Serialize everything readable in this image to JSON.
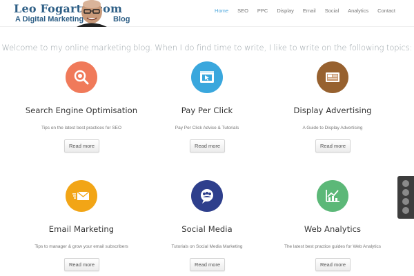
{
  "logo": {
    "name": "Leo Fogarty .com",
    "tagline": "A Digital Marketing",
    "tagline_end": "Blog"
  },
  "nav": {
    "items": [
      {
        "label": "Home",
        "active": true
      },
      {
        "label": "SEO",
        "active": false
      },
      {
        "label": "PPC",
        "active": false
      },
      {
        "label": "Display",
        "active": false
      },
      {
        "label": "Email",
        "active": false
      },
      {
        "label": "Social",
        "active": false
      },
      {
        "label": "Analytics",
        "active": false
      },
      {
        "label": "Contact",
        "active": false
      }
    ]
  },
  "intro": "Welcome to my online marketing blog. When I do find time to write, I like to write on the following topics:",
  "features": [
    {
      "title": "Search Engine Optimisation",
      "desc": "Tips on the latest best practices for SEO",
      "button": "Read more",
      "icon": "search-icon",
      "color": "#f07a5a"
    },
    {
      "title": "Pay Per Click",
      "desc": "Pay Per Click Advice & Tutorials",
      "button": "Read more",
      "icon": "browser-click-icon",
      "color": "#3aa7dd"
    },
    {
      "title": "Display Advertising",
      "desc": "A Guide to Display Advertising",
      "button": "Read more",
      "icon": "ad-display-icon",
      "color": "#97612f"
    },
    {
      "title": "Email Marketing",
      "desc": "Tips to manager & grow your email subscribers",
      "button": "Read more",
      "icon": "envelope-icon",
      "color": "#f2a516"
    },
    {
      "title": "Social Media",
      "desc": "Tutorials on Social Media Marketing",
      "button": "Read more",
      "icon": "social-chat-icon",
      "color": "#2e3f8c"
    },
    {
      "title": "Web Analytics",
      "desc": "The latest best practice guides for Web Analytics",
      "button": "Read more",
      "icon": "analytics-chart-icon",
      "color": "#5cb878"
    }
  ],
  "social": {
    "items": [
      {
        "icon": "facebook-icon",
        "glyph": "f"
      },
      {
        "icon": "twitter-icon",
        "glyph": "t"
      },
      {
        "icon": "googleplus-icon",
        "glyph": "g"
      },
      {
        "icon": "rss-icon",
        "glyph": "r"
      }
    ]
  },
  "colors": {
    "brand": "#2e5f86",
    "nav_active": "#4aa6dc"
  }
}
